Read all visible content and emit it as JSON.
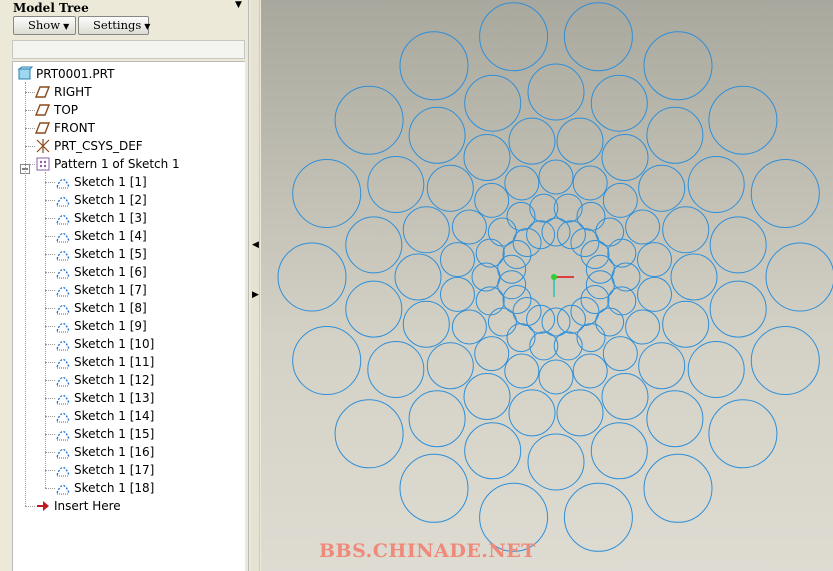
{
  "model_tree": {
    "title": "Model Tree",
    "show_label": "Show",
    "settings_label": "Settings",
    "root": "PRT0001.PRT",
    "datums": [
      {
        "label": "RIGHT",
        "icon": "datum-plane-icon"
      },
      {
        "label": "TOP",
        "icon": "datum-plane-icon"
      },
      {
        "label": "FRONT",
        "icon": "datum-plane-icon"
      },
      {
        "label": "PRT_CSYS_DEF",
        "icon": "csys-icon"
      }
    ],
    "pattern_label": "Pattern 1 of Sketch 1",
    "sketches": [
      "Sketch 1 [1]",
      "Sketch 1 [2]",
      "Sketch 1 [3]",
      "Sketch 1 [4]",
      "Sketch 1 [5]",
      "Sketch 1 [6]",
      "Sketch 1 [7]",
      "Sketch 1 [8]",
      "Sketch 1 [9]",
      "Sketch 1 [10]",
      "Sketch 1 [11]",
      "Sketch 1 [12]",
      "Sketch 1 [13]",
      "Sketch 1 [14]",
      "Sketch 1 [15]",
      "Sketch 1 [16]",
      "Sketch 1 [17]",
      "Sketch 1 [18]"
    ],
    "insert_label": "Insert Here"
  },
  "graphics": {
    "watermark": "BBS.CHINADE.NET",
    "circle_color": "#2f8fd8",
    "pattern_count": 18,
    "rings": [
      {
        "r": 14,
        "dist": 45
      },
      {
        "r": 14,
        "dist": 70
      },
      {
        "r": 17,
        "dist": 100
      },
      {
        "r": 23,
        "dist": 138
      },
      {
        "r": 28,
        "dist": 185
      },
      {
        "r": 34,
        "dist": 244
      }
    ]
  },
  "colors": {
    "accent": "#2f8fd8",
    "panel": "#ece9d8",
    "watermark": "#ef8a7a"
  }
}
